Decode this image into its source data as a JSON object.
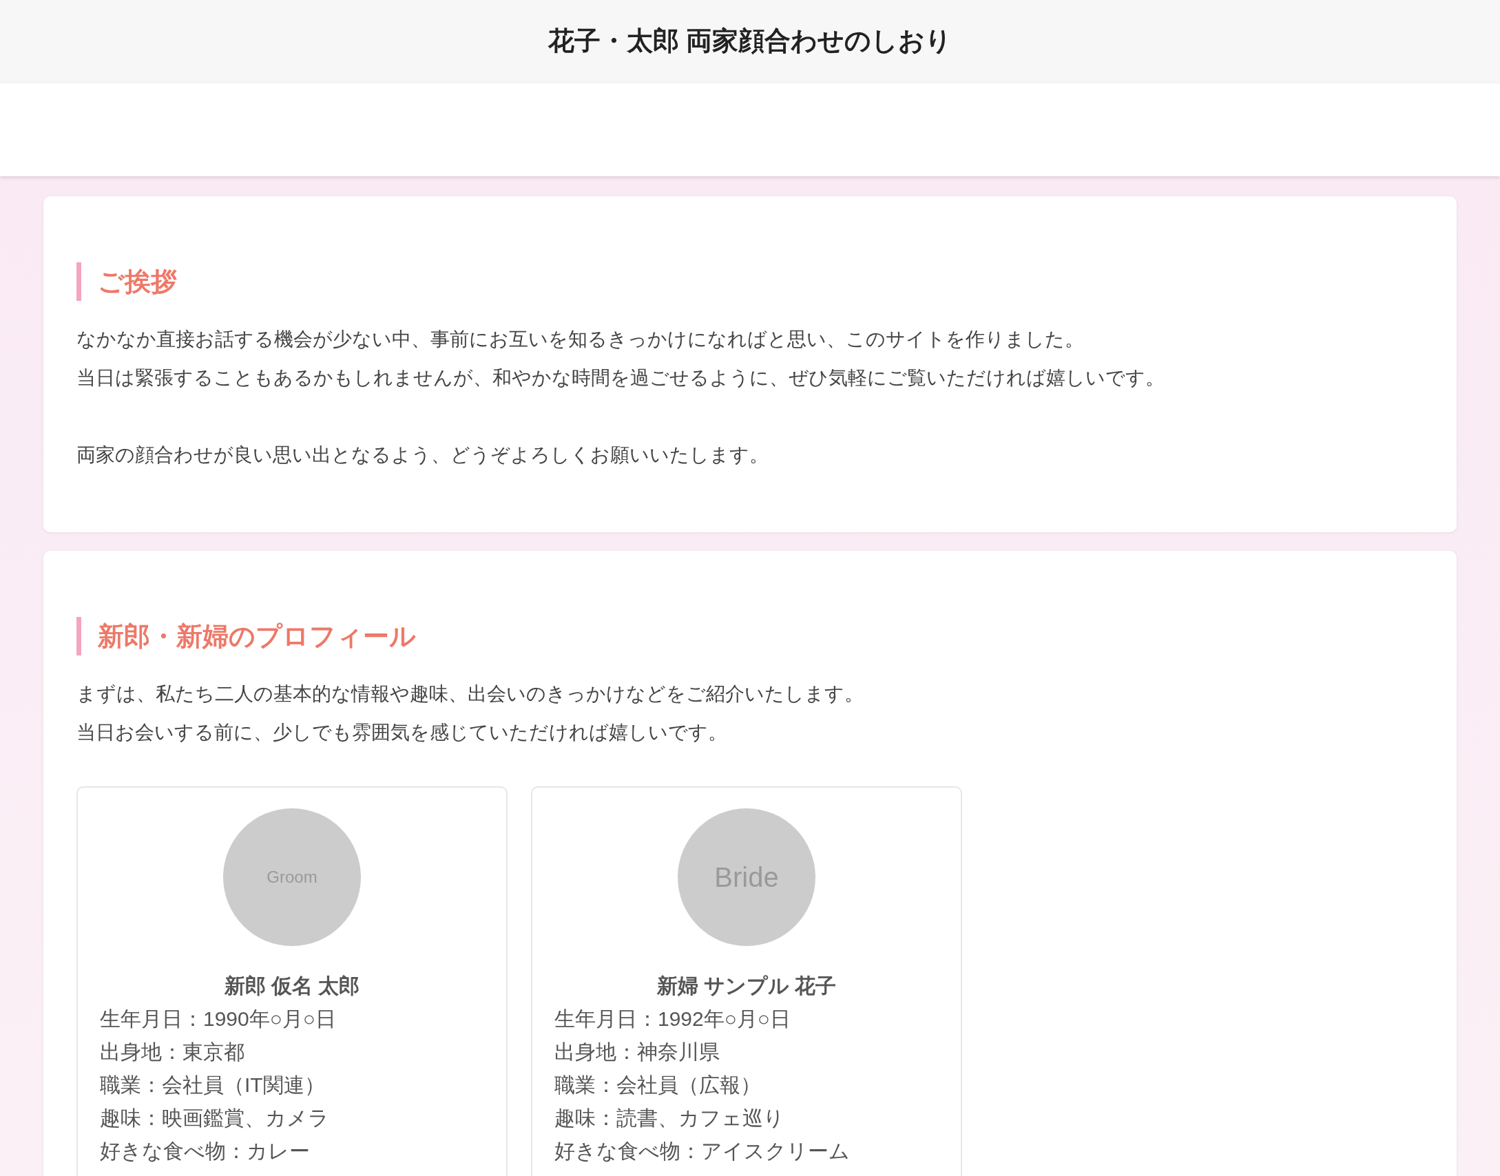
{
  "header": {
    "title": "花子・太郎 両家顔合わせのしおり"
  },
  "sections": [
    {
      "kind": "text",
      "heading": "ご挨拶",
      "paragraphs": [
        [
          "なかなか直接お話する機会が少ない中、事前にお互いを知るきっかけになればと思い、このサイトを作りました。",
          "当日は緊張することもあるかもしれませんが、和やかな時間を過ごせるように、ぜひ気軽にご覧いただければ嬉しいです。"
        ],
        [
          "両家の顔合わせが良い思い出となるよう、どうぞよろしくお願いいたします。"
        ]
      ]
    },
    {
      "kind": "profiles",
      "heading": "新郎・新婦のプロフィール",
      "paragraphs": [
        [
          "まずは、私たち二人の基本的な情報や趣味、出会いのきっかけなどをご紹介いたします。",
          "当日お会いする前に、少しでも雰囲気を感じていただければ嬉しいです。"
        ]
      ],
      "profiles": [
        {
          "kind": "compact",
          "avatar_label": "Groom",
          "name": "新郎 仮名 太郎",
          "details": [
            "生年月日：1990年○月○日",
            "出身地：東京都",
            "職業：会社員（IT関連）",
            "趣味：映画鑑賞、カメラ",
            "好きな食べ物：カレー"
          ]
        },
        {
          "kind": "large",
          "avatar_label": "Bride",
          "name": "新婦 サンプル 花子",
          "details": [
            "生年月日：1992年○月○日",
            "出身地：神奈川県",
            "職業：会社員（広報）",
            "趣味：読書、カフェ巡り",
            "好きな食べ物：アイスクリーム"
          ]
        }
      ]
    }
  ]
}
